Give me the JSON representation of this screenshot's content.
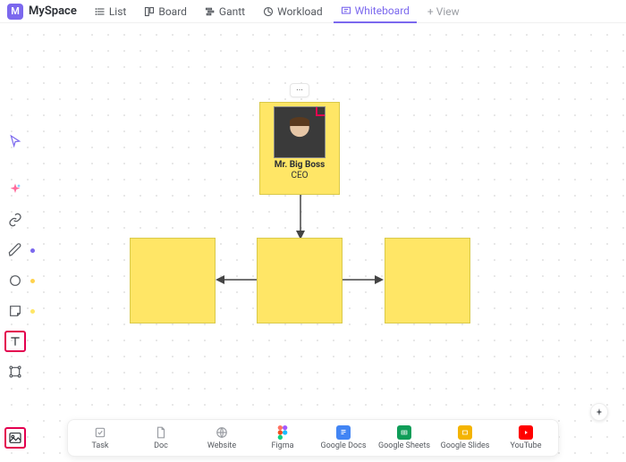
{
  "workspace": {
    "badge": "M",
    "name": "MySpace"
  },
  "tabs": [
    {
      "label": "List"
    },
    {
      "label": "Board"
    },
    {
      "label": "Gantt"
    },
    {
      "label": "Workload"
    },
    {
      "label": "Whiteboard",
      "active": true
    },
    {
      "label": "+ View"
    }
  ],
  "toolbar": {
    "items": [
      "select",
      "ai",
      "link",
      "pen",
      "shape",
      "sticky",
      "text",
      "connector",
      "image"
    ],
    "highlighted": [
      "text",
      "image"
    ]
  },
  "whiteboard": {
    "top_note": {
      "name": "Mr. Big Boss",
      "title": "CEO",
      "more": "···"
    },
    "child_notes": 3
  },
  "dock": {
    "items": [
      {
        "label": "Task",
        "color": "#b5b9bf"
      },
      {
        "label": "Doc",
        "color": "#b5b9bf"
      },
      {
        "label": "Website",
        "color": "#b5b9bf"
      },
      {
        "label": "Figma",
        "color": "#ff7262"
      },
      {
        "label": "Google Docs",
        "color": "#4285f4"
      },
      {
        "label": "Google Sheets",
        "color": "#0f9d58"
      },
      {
        "label": "Google Slides",
        "color": "#f4b400"
      },
      {
        "label": "YouTube",
        "color": "#ff0000"
      }
    ]
  }
}
